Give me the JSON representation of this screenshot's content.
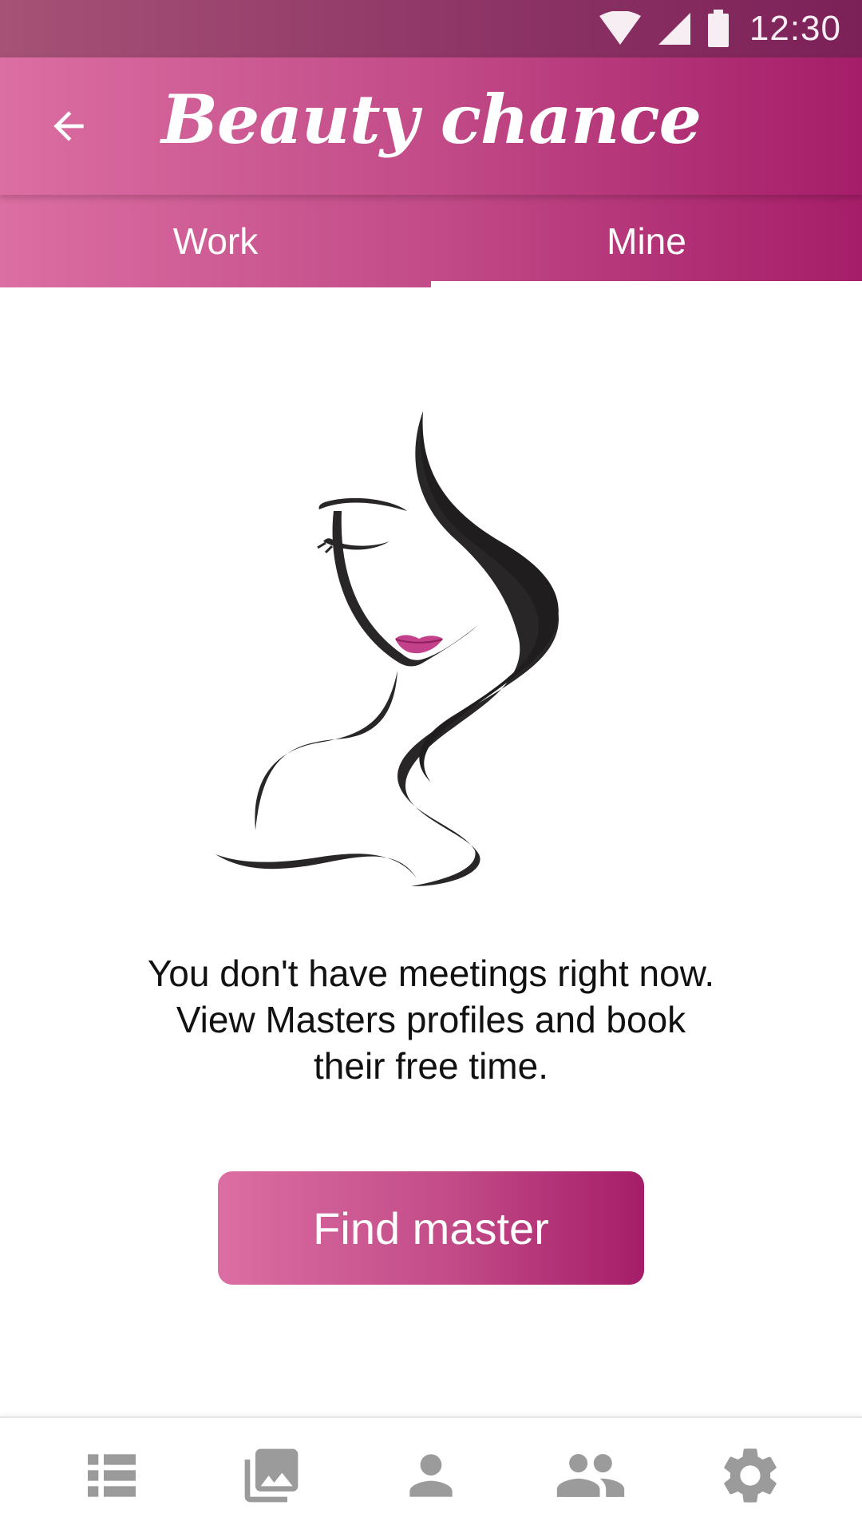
{
  "status_bar": {
    "time": "12:30",
    "icons": [
      "wifi-icon",
      "cell-signal-icon",
      "battery-icon"
    ]
  },
  "app_bar": {
    "title": "Beauty chance",
    "back_icon": "arrow-back-icon"
  },
  "tabs": [
    {
      "label": "Work",
      "selected": false
    },
    {
      "label": "Mine",
      "selected": true
    }
  ],
  "empty_state": {
    "illustration": "woman-face-hair-illustration",
    "message_lines": [
      "You don't have meetings right now.",
      "View Masters profiles and book",
      "their free time."
    ],
    "button_label": "Find master"
  },
  "bottom_nav": {
    "items": [
      {
        "icon": "list-icon"
      },
      {
        "icon": "gallery-icon"
      },
      {
        "icon": "person-icon"
      },
      {
        "icon": "people-icon"
      },
      {
        "icon": "settings-gear-icon"
      }
    ]
  },
  "colors": {
    "accent_start": "#db6ea2",
    "accent_end": "#a51d68",
    "status_bar": "#8c3365",
    "nav_icon": "#9b9b9b",
    "lips": "#c3408a"
  }
}
